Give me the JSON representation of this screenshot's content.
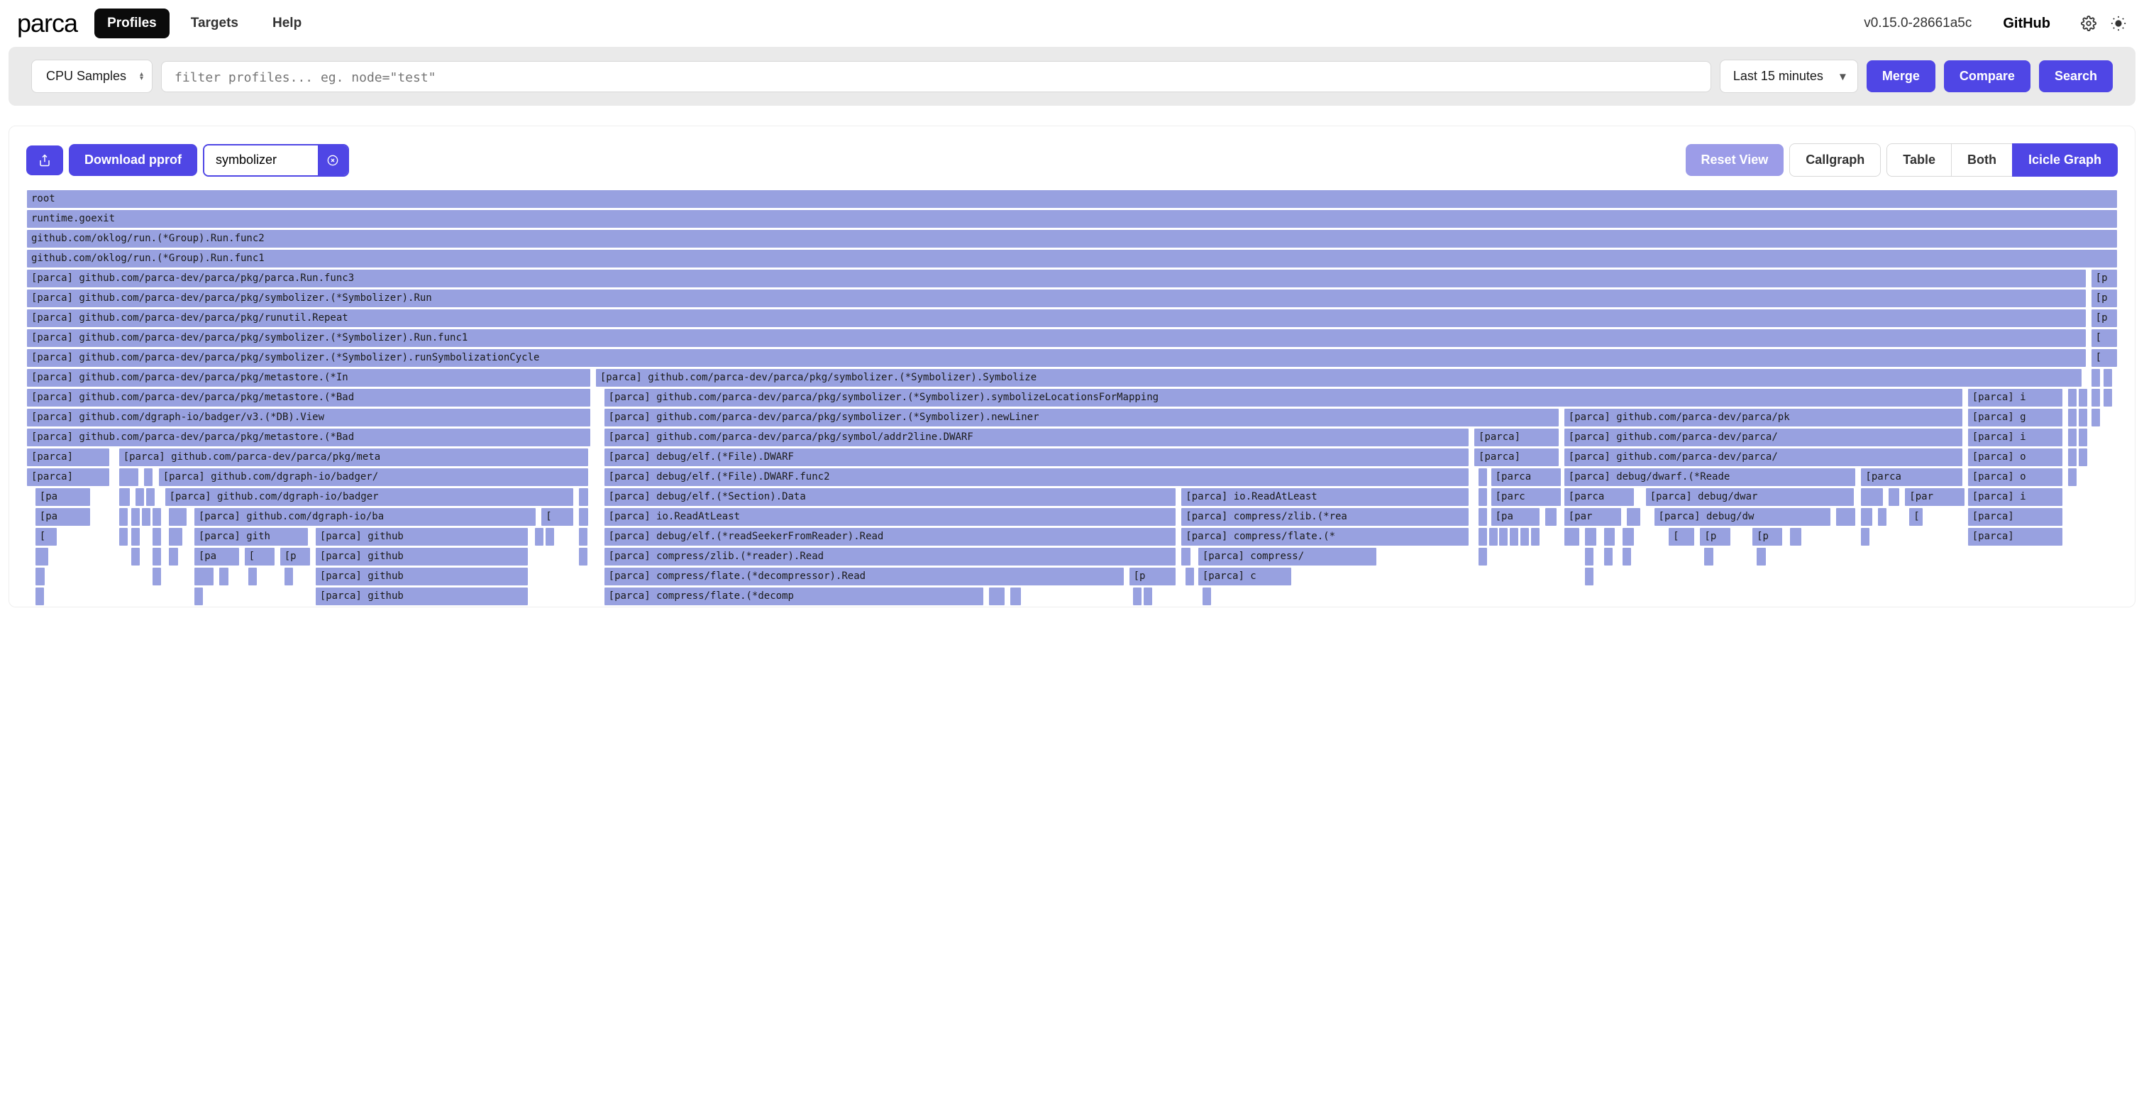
{
  "header": {
    "logo": "parca",
    "nav": [
      "Profiles",
      "Targets",
      "Help"
    ],
    "active_nav": 0,
    "version": "v0.15.0-28661a5c",
    "github": "GitHub"
  },
  "query": {
    "profile_type": "CPU Samples",
    "filter_placeholder": "filter profiles... eg. node=\"test\"",
    "filter_value": "",
    "time_range": "Last 15 minutes",
    "merge_label": "Merge",
    "compare_label": "Compare",
    "search_label": "Search"
  },
  "toolbar": {
    "download_label": "Download pprof",
    "search_value": "symbolizer",
    "reset_label": "Reset View",
    "view_modes": [
      "Callgraph",
      "Table",
      "Both",
      "Icicle Graph"
    ],
    "active_view": 3
  },
  "flame": {
    "rows": [
      [
        {
          "l": 0,
          "w": 100,
          "t": "root"
        }
      ],
      [
        {
          "l": 0,
          "w": 100,
          "t": "runtime.goexit"
        }
      ],
      [
        {
          "l": 0,
          "w": 100,
          "t": "github.com/oklog/run.(*Group).Run.func2"
        }
      ],
      [
        {
          "l": 0,
          "w": 100,
          "t": "github.com/oklog/run.(*Group).Run.func1"
        }
      ],
      [
        {
          "l": 0,
          "w": 98.5,
          "t": "[parca] github.com/parca-dev/parca/pkg/parca.Run.func3"
        },
        {
          "l": 98.7,
          "w": 1.3,
          "t": "[p"
        }
      ],
      [
        {
          "l": 0,
          "w": 98.5,
          "t": "[parca] github.com/parca-dev/parca/pkg/symbolizer.(*Symbolizer).Run"
        },
        {
          "l": 98.7,
          "w": 1.3,
          "t": "[p"
        }
      ],
      [
        {
          "l": 0,
          "w": 98.5,
          "t": "[parca] github.com/parca-dev/parca/pkg/runutil.Repeat"
        },
        {
          "l": 98.7,
          "w": 1.3,
          "t": "[p"
        }
      ],
      [
        {
          "l": 0,
          "w": 98.5,
          "t": "[parca] github.com/parca-dev/parca/pkg/symbolizer.(*Symbolizer).Run.func1"
        },
        {
          "l": 98.7,
          "w": 1.3,
          "t": "["
        }
      ],
      [
        {
          "l": 0,
          "w": 98.5,
          "t": "[parca] github.com/parca-dev/parca/pkg/symbolizer.(*Symbolizer).runSymbolizationCycle"
        },
        {
          "l": 98.7,
          "w": 1.3,
          "t": "["
        }
      ],
      [
        {
          "l": 0,
          "w": 27,
          "t": "[parca] github.com/parca-dev/parca/pkg/metastore.(*In"
        },
        {
          "l": 27.2,
          "w": 71.1,
          "t": "[parca] github.com/parca-dev/parca/pkg/symbolizer.(*Symbolizer).Symbolize"
        },
        {
          "l": 98.7,
          "w": 0.3,
          "t": ""
        },
        {
          "l": 99.3,
          "w": 0.4,
          "t": ""
        }
      ],
      [
        {
          "l": 0,
          "w": 27,
          "t": "[parca] github.com/parca-dev/parca/pkg/metastore.(*Bad"
        },
        {
          "l": 27.6,
          "w": 65,
          "t": "[parca] github.com/parca-dev/parca/pkg/symbolizer.(*Symbolizer).symbolizeLocationsForMapping"
        },
        {
          "l": 92.8,
          "w": 4.6,
          "t": "[parca] i"
        },
        {
          "l": 97.6,
          "w": 0.3,
          "t": ""
        },
        {
          "l": 98.1,
          "w": 0.3,
          "t": ""
        },
        {
          "l": 98.7,
          "w": 0.3,
          "t": ""
        },
        {
          "l": 99.3,
          "w": 0.3,
          "t": ""
        }
      ],
      [
        {
          "l": 0,
          "w": 27,
          "t": "[parca] github.com/dgraph-io/badger/v3.(*DB).View"
        },
        {
          "l": 27.6,
          "w": 45.7,
          "t": "[parca] github.com/parca-dev/parca/pkg/symbolizer.(*Symbolizer).newLiner"
        },
        {
          "l": 73.5,
          "w": 19.1,
          "t": "[parca] github.com/parca-dev/parca/pk"
        },
        {
          "l": 92.8,
          "w": 4.6,
          "t": "[parca] g"
        },
        {
          "l": 97.6,
          "w": 0.3,
          "t": ""
        },
        {
          "l": 98.1,
          "w": 0.3,
          "t": ""
        },
        {
          "l": 98.7,
          "w": 0.3,
          "t": ""
        }
      ],
      [
        {
          "l": 0,
          "w": 27,
          "t": "[parca] github.com/parca-dev/parca/pkg/metastore.(*Bad"
        },
        {
          "l": 27.6,
          "w": 41.4,
          "t": "[parca] github.com/parca-dev/parca/pkg/symbol/addr2line.DWARF"
        },
        {
          "l": 69.2,
          "w": 4.1,
          "t": "[parca]"
        },
        {
          "l": 73.5,
          "w": 19.1,
          "t": "[parca] github.com/parca-dev/parca/"
        },
        {
          "l": 92.8,
          "w": 4.6,
          "t": "[parca] i"
        },
        {
          "l": 97.6,
          "w": 0.3,
          "t": ""
        },
        {
          "l": 98.1,
          "w": 0.3,
          "t": ""
        }
      ],
      [
        {
          "l": 0,
          "w": 4,
          "t": "[parca]"
        },
        {
          "l": 4.4,
          "w": 22.5,
          "t": "[parca] github.com/parca-dev/parca/pkg/meta"
        },
        {
          "l": 27.6,
          "w": 41.4,
          "t": "[parca] debug/elf.(*File).DWARF"
        },
        {
          "l": 69.2,
          "w": 4.1,
          "t": "[parca]"
        },
        {
          "l": 73.5,
          "w": 19.1,
          "t": "[parca] github.com/parca-dev/parca/"
        },
        {
          "l": 92.8,
          "w": 4.6,
          "t": "[parca] o"
        },
        {
          "l": 97.6,
          "w": 0.3,
          "t": ""
        },
        {
          "l": 98.1,
          "w": 0.3,
          "t": ""
        }
      ],
      [
        {
          "l": 0,
          "w": 4,
          "t": "[parca]"
        },
        {
          "l": 4.4,
          "w": 1,
          "t": ""
        },
        {
          "l": 5.6,
          "w": 0.4,
          "t": ""
        },
        {
          "l": 6.3,
          "w": 20.6,
          "t": "[parca] github.com/dgraph-io/badger/"
        },
        {
          "l": 27.6,
          "w": 41.4,
          "t": "[parca] debug/elf.(*File).DWARF.func2"
        },
        {
          "l": 69.4,
          "w": 0.4,
          "t": ""
        },
        {
          "l": 70,
          "w": 3.4,
          "t": "[parca"
        },
        {
          "l": 73.5,
          "w": 14,
          "t": "[parca] debug/dwarf.(*Reade"
        },
        {
          "l": 87.7,
          "w": 4.9,
          "t": "[parca"
        },
        {
          "l": 92.8,
          "w": 4.6,
          "t": "[parca] o"
        },
        {
          "l": 97.6,
          "w": 0.3,
          "t": ""
        }
      ],
      [
        {
          "l": 0.4,
          "w": 2.7,
          "t": "[pa"
        },
        {
          "l": 4.4,
          "w": 0.6,
          "t": ""
        },
        {
          "l": 5.2,
          "w": 0.3,
          "t": ""
        },
        {
          "l": 5.7,
          "w": 0.4,
          "t": ""
        },
        {
          "l": 6.6,
          "w": 19.6,
          "t": "[parca] github.com/dgraph-io/badger"
        },
        {
          "l": 26.4,
          "w": 0.5,
          "t": ""
        },
        {
          "l": 27.6,
          "w": 27.4,
          "t": "[parca] debug/elf.(*Section).Data"
        },
        {
          "l": 55.2,
          "w": 13.8,
          "t": "[parca] io.ReadAtLeast"
        },
        {
          "l": 69.4,
          "w": 0.3,
          "t": ""
        },
        {
          "l": 70,
          "w": 3.4,
          "t": "[parc"
        },
        {
          "l": 73.5,
          "w": 3.4,
          "t": "[parca"
        },
        {
          "l": 77.4,
          "w": 10,
          "t": "[parca] debug/dwar"
        },
        {
          "l": 87.7,
          "w": 1.1,
          "t": ""
        },
        {
          "l": 89,
          "w": 0.6,
          "t": ""
        },
        {
          "l": 89.8,
          "w": 2.9,
          "t": "[par"
        },
        {
          "l": 92.8,
          "w": 4.6,
          "t": "[parca] i"
        }
      ],
      [
        {
          "l": 0.4,
          "w": 2.7,
          "t": "[pa"
        },
        {
          "l": 4.4,
          "w": 0.3,
          "t": ""
        },
        {
          "l": 5,
          "w": 0.3,
          "t": ""
        },
        {
          "l": 5.5,
          "w": 0.3,
          "t": ""
        },
        {
          "l": 6,
          "w": 0.3,
          "t": ""
        },
        {
          "l": 6.8,
          "w": 0.9,
          "t": ""
        },
        {
          "l": 8,
          "w": 16.4,
          "t": "[parca] github.com/dgraph-io/ba"
        },
        {
          "l": 24.6,
          "w": 1.6,
          "t": "["
        },
        {
          "l": 26.4,
          "w": 0.5,
          "t": ""
        },
        {
          "l": 27.6,
          "w": 27.4,
          "t": "[parca] io.ReadAtLeast"
        },
        {
          "l": 55.2,
          "w": 13.8,
          "t": "[parca] compress/zlib.(*rea"
        },
        {
          "l": 69.4,
          "w": 0.3,
          "t": ""
        },
        {
          "l": 70,
          "w": 2.4,
          "t": "[pa"
        },
        {
          "l": 72.6,
          "w": 0.6,
          "t": ""
        },
        {
          "l": 73.5,
          "w": 2.8,
          "t": "[par"
        },
        {
          "l": 76.5,
          "w": 0.7,
          "t": ""
        },
        {
          "l": 77.8,
          "w": 8.5,
          "t": "[parca] debug/dw"
        },
        {
          "l": 86.5,
          "w": 1,
          "t": ""
        },
        {
          "l": 87.7,
          "w": 0.6,
          "t": ""
        },
        {
          "l": 88.5,
          "w": 0.3,
          "t": ""
        },
        {
          "l": 90,
          "w": 0.7,
          "t": "["
        },
        {
          "l": 92.8,
          "w": 4.6,
          "t": "[parca]"
        }
      ],
      [
        {
          "l": 0.4,
          "w": 1.1,
          "t": "["
        },
        {
          "l": 4.4,
          "w": 0.3,
          "t": ""
        },
        {
          "l": 5,
          "w": 0.3,
          "t": ""
        },
        {
          "l": 6,
          "w": 0.3,
          "t": ""
        },
        {
          "l": 6.8,
          "w": 0.7,
          "t": ""
        },
        {
          "l": 8,
          "w": 5.5,
          "t": "[parca] gith"
        },
        {
          "l": 13.8,
          "w": 10.2,
          "t": "[parca] github"
        },
        {
          "l": 24.3,
          "w": 0.3,
          "t": ""
        },
        {
          "l": 24.8,
          "w": 0.3,
          "t": ""
        },
        {
          "l": 26.4,
          "w": 0.3,
          "t": ""
        },
        {
          "l": 27.6,
          "w": 27.4,
          "t": "[parca] debug/elf.(*readSeekerFromReader).Read"
        },
        {
          "l": 55.2,
          "w": 13.8,
          "t": "[parca] compress/flate.(*"
        },
        {
          "l": 69.4,
          "w": 0.3,
          "t": ""
        },
        {
          "l": 69.9,
          "w": 0.3,
          "t": ""
        },
        {
          "l": 70.4,
          "w": 0.3,
          "t": ""
        },
        {
          "l": 70.9,
          "w": 0.3,
          "t": ""
        },
        {
          "l": 71.4,
          "w": 0.3,
          "t": ""
        },
        {
          "l": 71.9,
          "w": 0.3,
          "t": ""
        },
        {
          "l": 73.5,
          "w": 0.8,
          "t": ""
        },
        {
          "l": 74.5,
          "w": 0.6,
          "t": ""
        },
        {
          "l": 75.4,
          "w": 0.6,
          "t": ""
        },
        {
          "l": 76.3,
          "w": 0.6,
          "t": ""
        },
        {
          "l": 78.5,
          "w": 1.3,
          "t": "["
        },
        {
          "l": 80,
          "w": 1.5,
          "t": "[p"
        },
        {
          "l": 82.5,
          "w": 1.5,
          "t": "[p"
        },
        {
          "l": 84.3,
          "w": 0.6,
          "t": ""
        },
        {
          "l": 87.7,
          "w": 0.3,
          "t": ""
        },
        {
          "l": 92.8,
          "w": 4.6,
          "t": "[parca]"
        }
      ],
      [
        {
          "l": 0.4,
          "w": 0.7,
          "t": ""
        },
        {
          "l": 5,
          "w": 0.3,
          "t": ""
        },
        {
          "l": 6,
          "w": 0.3,
          "t": ""
        },
        {
          "l": 6.8,
          "w": 0.5,
          "t": ""
        },
        {
          "l": 8,
          "w": 2.2,
          "t": "[pa"
        },
        {
          "l": 10.4,
          "w": 1.5,
          "t": "["
        },
        {
          "l": 12.1,
          "w": 1.5,
          "t": "[p"
        },
        {
          "l": 13.8,
          "w": 10.2,
          "t": "[parca] github"
        },
        {
          "l": 26.4,
          "w": 0.3,
          "t": ""
        },
        {
          "l": 27.6,
          "w": 27.4,
          "t": "[parca] compress/zlib.(*reader).Read"
        },
        {
          "l": 55.2,
          "w": 0.5,
          "t": ""
        },
        {
          "l": 56,
          "w": 8.6,
          "t": "[parca] compress/"
        },
        {
          "l": 69.4,
          "w": 0.3,
          "t": ""
        },
        {
          "l": 74.5,
          "w": 0.3,
          "t": ""
        },
        {
          "l": 75.4,
          "w": 0.3,
          "t": ""
        },
        {
          "l": 76.3,
          "w": 0.3,
          "t": ""
        },
        {
          "l": 80.2,
          "w": 0.5,
          "t": ""
        },
        {
          "l": 82.7,
          "w": 0.5,
          "t": ""
        }
      ],
      [
        {
          "l": 0.4,
          "w": 0.5,
          "t": ""
        },
        {
          "l": 6,
          "w": 0.3,
          "t": ""
        },
        {
          "l": 8,
          "w": 1,
          "t": ""
        },
        {
          "l": 9.2,
          "w": 0.5,
          "t": ""
        },
        {
          "l": 10.6,
          "w": 0.4,
          "t": ""
        },
        {
          "l": 12.3,
          "w": 0.4,
          "t": ""
        },
        {
          "l": 13.8,
          "w": 10.2,
          "t": "[parca] github"
        },
        {
          "l": 27.6,
          "w": 24.9,
          "t": "[parca] compress/flate.(*decompressor).Read"
        },
        {
          "l": 52.7,
          "w": 2.3,
          "t": "[p"
        },
        {
          "l": 55.4,
          "w": 0.3,
          "t": ""
        },
        {
          "l": 56,
          "w": 4.5,
          "t": "[parca] c"
        },
        {
          "l": 74.5,
          "w": 0.2,
          "t": ""
        }
      ],
      [
        {
          "l": 0.4,
          "w": 0.4,
          "t": ""
        },
        {
          "l": 8,
          "w": 0.4,
          "t": ""
        },
        {
          "l": 13.8,
          "w": 10.2,
          "t": "[parca] github"
        },
        {
          "l": 27.6,
          "w": 18.2,
          "t": "[parca] compress/flate.(*decomp"
        },
        {
          "l": 46,
          "w": 0.8,
          "t": ""
        },
        {
          "l": 47,
          "w": 0.6,
          "t": ""
        },
        {
          "l": 52.9,
          "w": 0.3,
          "t": ""
        },
        {
          "l": 53.4,
          "w": 0.3,
          "t": ""
        },
        {
          "l": 56.2,
          "w": 0.3,
          "t": ""
        }
      ]
    ]
  }
}
